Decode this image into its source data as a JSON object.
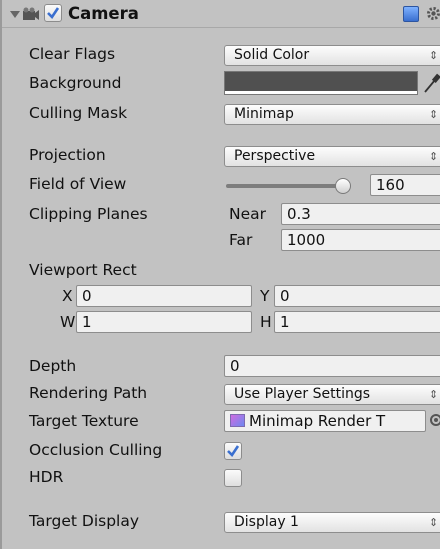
{
  "component": {
    "title": "Camera",
    "enabled": true
  },
  "fields": {
    "clear_flags": {
      "label": "Clear Flags",
      "value": "Solid Color"
    },
    "background": {
      "label": "Background",
      "color": "#505050"
    },
    "culling_mask": {
      "label": "Culling Mask",
      "value": "Minimap"
    },
    "projection": {
      "label": "Projection",
      "value": "Perspective"
    },
    "field_of_view": {
      "label": "Field of View",
      "value": "160"
    },
    "clipping_planes": {
      "label": "Clipping Planes",
      "near_label": "Near",
      "near_value": "0.3",
      "far_label": "Far",
      "far_value": "1000"
    },
    "viewport_rect": {
      "label": "Viewport Rect",
      "x_label": "X",
      "x_value": "0",
      "y_label": "Y",
      "y_value": "0",
      "w_label": "W",
      "w_value": "1",
      "h_label": "H",
      "h_value": "1"
    },
    "depth": {
      "label": "Depth",
      "value": "0"
    },
    "rendering_path": {
      "label": "Rendering Path",
      "value": "Use Player Settings"
    },
    "target_texture": {
      "label": "Target Texture",
      "value": "Minimap Render T"
    },
    "occlusion_culling": {
      "label": "Occlusion Culling",
      "checked": true
    },
    "hdr": {
      "label": "HDR",
      "checked": false
    },
    "target_display": {
      "label": "Target Display",
      "value": "Display 1"
    }
  },
  "icons": {
    "fold": "triangle-down-icon",
    "camera": "camera-icon",
    "help": "help-book-icon",
    "settings": "gear-icon",
    "picker": "eyedropper-icon",
    "target": "object-picker-icon",
    "dropdown": "up-down-arrows-icon"
  },
  "dropdown_arrows": "⇕",
  "colors": {
    "panel": "#c2c2c2",
    "field": "#f0f0f0",
    "check": "#3a6fcf"
  }
}
